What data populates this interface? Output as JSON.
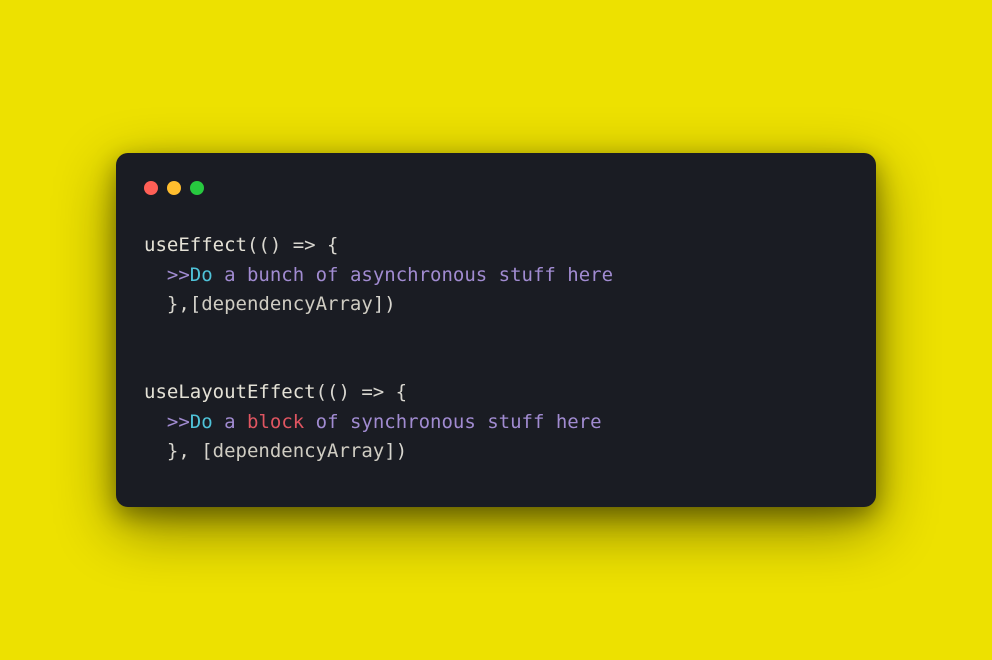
{
  "traffic_lights": {
    "red": "#ff5f56",
    "yellow": "#ffbd2e",
    "green": "#27c93f"
  },
  "code": {
    "block1": {
      "line1": {
        "fn": "useEffect",
        "rest": "(() => {"
      },
      "line2": {
        "indent": "  ",
        "arrows": ">>",
        "do": "Do",
        "rest": " a bunch of asynchronous stuff here"
      },
      "line3": {
        "indent": "  ",
        "close": "},[",
        "dep": "dependencyArray",
        "end": "])"
      }
    },
    "block2": {
      "line1": {
        "fn": "useLayoutEffect",
        "rest": "(() => {"
      },
      "line2": {
        "indent": "  ",
        "arrows": ">>",
        "do": "Do",
        "mid1": " a ",
        "block": "block",
        "rest": " of synchronous stuff here"
      },
      "line3": {
        "indent": "  ",
        "close": "}, [",
        "dep": "dependencyArray",
        "end": "])"
      }
    }
  }
}
